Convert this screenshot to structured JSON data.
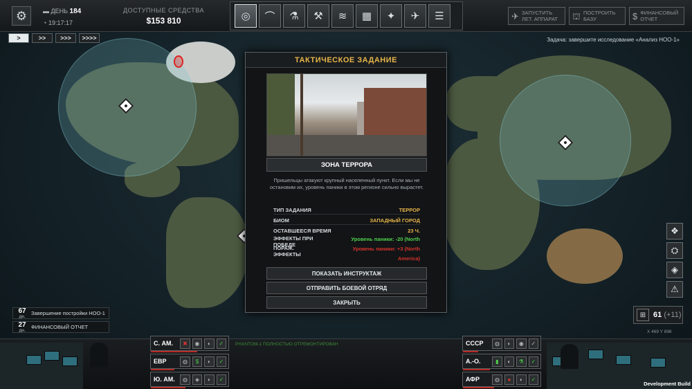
{
  "hud": {
    "day_label": "ДЕНЬ",
    "day_value": "184",
    "time": "19:17:17",
    "funds_label": "ДОСТУПНЫЕ СРЕДСТВА",
    "funds_value": "$153 810",
    "tabs": [
      {
        "icon": "globe-icon",
        "glyph": "◎",
        "active": true
      },
      {
        "icon": "hangar-icon",
        "glyph": "⌒",
        "active": false
      },
      {
        "icon": "research-icon",
        "glyph": "⚗",
        "active": false
      },
      {
        "icon": "engineering-icon",
        "glyph": "⚒",
        "active": false
      },
      {
        "icon": "soldiers-icon",
        "glyph": "≋",
        "active": false
      },
      {
        "icon": "facilities-icon",
        "glyph": "▦",
        "active": false
      },
      {
        "icon": "weapons-icon",
        "glyph": "✦",
        "active": false
      },
      {
        "icon": "aircraft-icon",
        "glyph": "✈",
        "active": false
      },
      {
        "icon": "archive-icon",
        "glyph": "☰",
        "active": false
      }
    ],
    "launch_aircraft": "ЗАПУСТИТЬ ЛЕТ. АППАРАТ",
    "build_base": "ПОСТРОИТЬ БАЗУ",
    "financial_report_btn": "ФИНАНСОВЫЙ ОТЧЕТ"
  },
  "speed": [
    ">",
    ">>",
    ">>>",
    ">>>>"
  ],
  "objective": "Задача: завершите исследование «Анализ НОО-1»",
  "dialog": {
    "title": "ТАКТИЧЕСКОЕ ЗАДАНИЕ",
    "zone": "ЗОНА ТЕРРОРА",
    "description": "Пришельцы атакуют крупный населенный пункт. Если мы не остановим их, уровень паники в этом регионе сильно вырастет.",
    "mission_type_label": "ТИП ЗАДАНИЯ",
    "mission_type_value": "ТЕРРОР",
    "biome_label": "БИОМ",
    "biome_value": "ЗАПАДНЫЙ ГОРОД",
    "time_left_label": "ОСТАВШЕЕСЯ ВРЕМЯ",
    "time_left_value": "23 Ч.",
    "win_effects_label": "ЭФФЕКТЫ ПРИ ПОБЕДЕ",
    "win_effects_value": "Уровень паники: -20 (North",
    "loss_effects_label": "ПОРАЖ. ЭФФЕКТЫ",
    "loss_effects_value": "Уровень паники: +3 (North",
    "loss_effects_value2": "America)",
    "btn_briefing": "ПОКАЗАТЬ ИНСТРУКТАЖ",
    "btn_send": "ОТПРАВИТЬ БОЕВОЙ ОТРЯД",
    "btn_close": "ЗАКРЫТЬ"
  },
  "events": [
    {
      "days": "67",
      "unit": "дн.",
      "text": "Завершение постройки НОО-1"
    },
    {
      "days": "27",
      "unit": "дн.",
      "text": "ФИНАНСОВЫЙ ОТЧЕТ"
    }
  ],
  "satellites": {
    "count": "61",
    "delta": "(+11)"
  },
  "coords": "X 469   Y 898",
  "log": "PHANTOM-1 ПОЛНОСТЬЮ ОТРЕМОНТИРОВАН",
  "regions_left": [
    "С. АМ.",
    "ЕВР",
    "Ю. АМ."
  ],
  "regions_right": [
    "СССР",
    "А.-О.",
    "АФР"
  ],
  "dev_build": "Development Build",
  "colors": {
    "accent": "#e7b64a",
    "positive": "#4fcf4a",
    "negative": "#d5332b"
  }
}
